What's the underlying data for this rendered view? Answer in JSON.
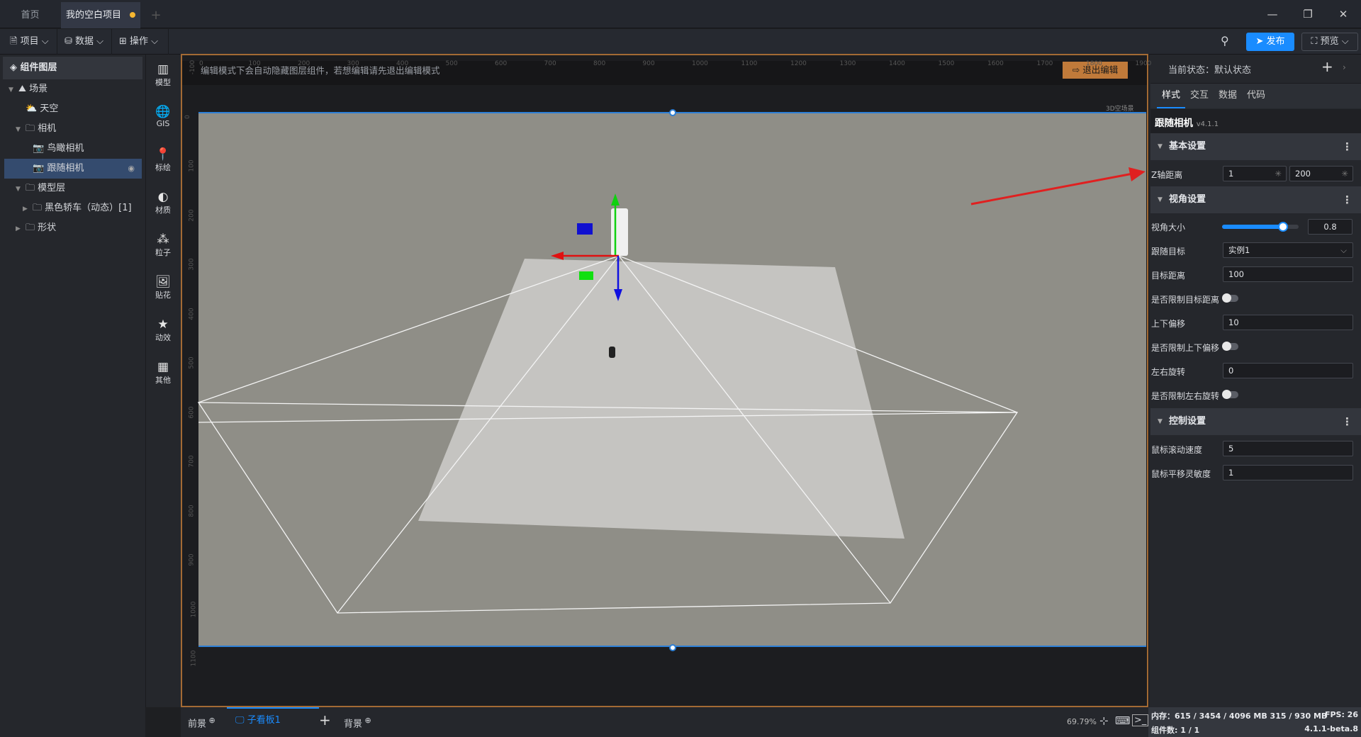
{
  "tabs": {
    "home": "首页",
    "project": "我的空白项目",
    "add": "+"
  },
  "window": {
    "minimize": "—",
    "restore": "❐",
    "close": "✕"
  },
  "menus": [
    {
      "label": "项目",
      "icon": "file-icon"
    },
    {
      "label": "数据",
      "icon": "database-icon"
    },
    {
      "label": "操作",
      "icon": "grid-icon"
    }
  ],
  "toolbar": {
    "publish": "发布",
    "preview": "预览"
  },
  "layers": {
    "title": "组件图层",
    "items": [
      {
        "label": "场景",
        "level": 0,
        "expanded": true,
        "icon": "scene-icon"
      },
      {
        "label": "天空",
        "level": 1,
        "icon": "sky-icon"
      },
      {
        "label": "相机",
        "level": 1,
        "expanded": true,
        "icon": "folder-icon"
      },
      {
        "label": "鸟瞰相机",
        "level": 2,
        "icon": "camera-icon"
      },
      {
        "label": "跟随相机",
        "level": 2,
        "icon": "camera-icon",
        "selected": true
      },
      {
        "label": "模型层",
        "level": 1,
        "expanded": true,
        "icon": "folder-icon"
      },
      {
        "label": "黑色轿车（动态）[1]",
        "level": 2,
        "expanded": false,
        "icon": "folder-icon"
      },
      {
        "label": "形状",
        "level": 1,
        "expanded": false,
        "icon": "folder-icon"
      }
    ]
  },
  "tools": [
    {
      "label": "模型"
    },
    {
      "label": "GIS"
    },
    {
      "label": "标绘"
    },
    {
      "label": "材质"
    },
    {
      "label": "粒子"
    },
    {
      "label": "贴花"
    },
    {
      "label": "动效"
    },
    {
      "label": "其他"
    }
  ],
  "canvas": {
    "hint": "编辑模式下会自动隐藏图层组件，若想编辑请先退出编辑模式",
    "exit": "退出编辑",
    "scene_label": "3D空场景",
    "ruler_x": [
      "0",
      "100",
      "200",
      "300",
      "400",
      "500",
      "600",
      "700",
      "800",
      "900",
      "1000",
      "1100",
      "1200",
      "1300",
      "1400",
      "1500",
      "1600",
      "1700",
      "1800",
      "1900"
    ],
    "ruler_y": [
      "-100",
      "0",
      "100",
      "200",
      "300",
      "400",
      "500",
      "600",
      "700",
      "800",
      "900",
      "1000",
      "1100"
    ]
  },
  "bottom": {
    "foreground": "前景",
    "board": "子看板1",
    "add": "+",
    "background": "背景",
    "zoom": "69.79%"
  },
  "panel": {
    "state": "当前状态：默认状态",
    "tabs": [
      "样式",
      "交互",
      "数据",
      "代码"
    ],
    "title": "跟随相机",
    "version": "v4.1.1",
    "sections": {
      "basic": "基本设置",
      "view": "视角设置",
      "control": "控制设置"
    },
    "z_label": "Z轴距离",
    "z_near": "1",
    "z_far": "200",
    "fov_label": "视角大小",
    "fov": "0.8",
    "fov_fraction": 0.8,
    "target_label": "跟随目标",
    "target": "实例1",
    "dist_label": "目标距离",
    "dist": "100",
    "limit_dist_label": "是否限制目标距离",
    "limit_dist": false,
    "offset_label": "上下偏移",
    "offset": "10",
    "limit_offset_label": "是否限制上下偏移",
    "limit_offset": false,
    "rot_label": "左右旋转",
    "rot": "0",
    "limit_rot_label": "是否限制左右旋转",
    "limit_rot": false,
    "wheel_label": "鼠标滚动速度",
    "wheel": "5",
    "pan_label": "鼠标平移灵敏度",
    "pan": "1"
  },
  "status": {
    "memory": "内存：615 / 3454 / 4096 MB  315 / 930 MB",
    "fps": "FPS:  26",
    "count": "组件数: 1 / 1",
    "version": "4.1.1-beta.8"
  },
  "colors": {
    "accent": "#1a8cff",
    "selected": "#344b6e",
    "exit": "#c07a3a",
    "highlight": "#e02020"
  }
}
